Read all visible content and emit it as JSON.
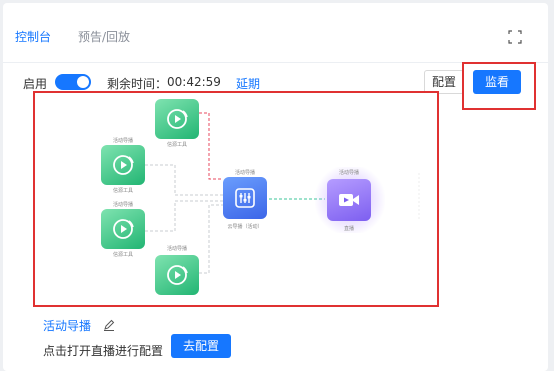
{
  "tabs": [
    {
      "label": "控制台",
      "active": true
    },
    {
      "label": "预告/回放",
      "active": false
    }
  ],
  "toolbar": {
    "enable_label": "启用",
    "enabled": true,
    "remaining_label": "剩余时间：",
    "remaining_time": "00:42:59",
    "extend_label": "延期",
    "config_label": "配置",
    "monitor_label": "监看"
  },
  "diagram": {
    "sources": [
      {
        "top_label": "",
        "bottom_label": "信源工具"
      },
      {
        "top_label": "活动导播",
        "bottom_label": "信源工具"
      },
      {
        "top_label": "活动导播",
        "bottom_label": "信源工具"
      },
      {
        "top_label": "活动导播",
        "bottom_label": ""
      }
    ],
    "cloud": {
      "top_label": "活动导播",
      "bottom_label": "云导播（活动）"
    },
    "live": {
      "top_label": "活动导播",
      "bottom_label": "直播"
    },
    "colors": {
      "source": "#22b573",
      "cloud": "#3c66e8",
      "live": "#7d5ff0",
      "red_line": "#e84a5f",
      "green_line": "#3cc49a"
    }
  },
  "footer": {
    "director_label": "活动导播",
    "hint": "点击打开直播进行配置",
    "go_config_label": "去配置"
  },
  "icons": {
    "expand": "expand-icon",
    "pencil": "pencil-icon",
    "source": "broadcast-play-icon",
    "cloud": "mixer-icon",
    "live": "video-camera-icon"
  }
}
